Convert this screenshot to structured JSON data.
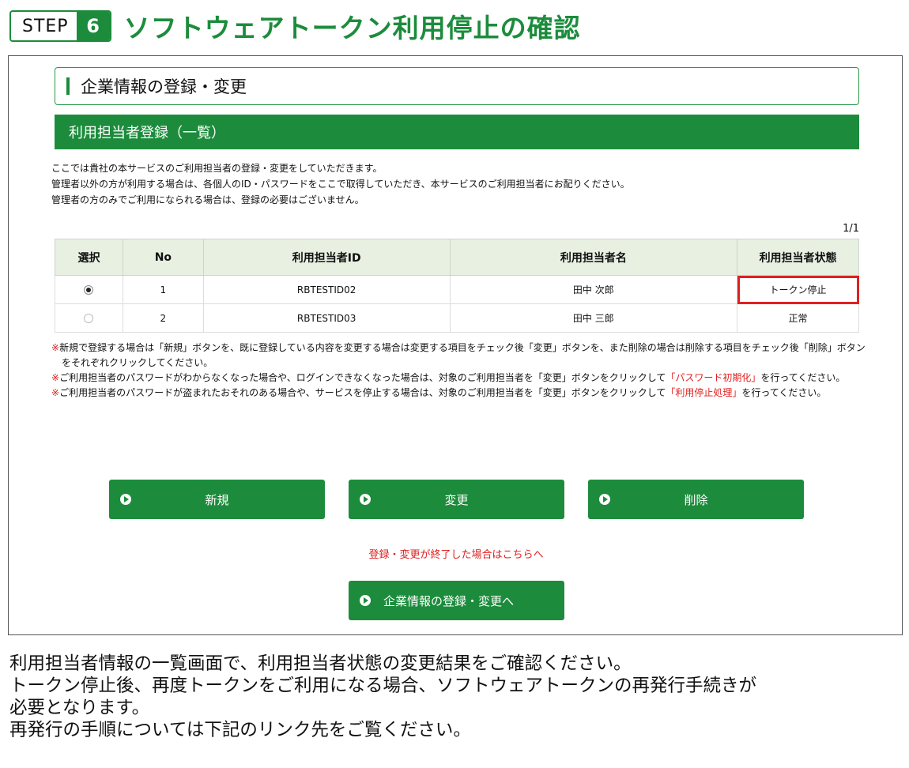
{
  "step": {
    "word": "STEP",
    "number": "6",
    "title": "ソフトウェアトークン利用停止の確認"
  },
  "section_title": "企業情報の登録・変更",
  "band_title": "利用担当者登録（一覧）",
  "intro_lines": [
    "ここでは貴社の本サービスのご利用担当者の登録・変更をしていただきます。",
    "管理者以外の方が利用する場合は、各個人のID・パスワードをここで取得していただき、本サービスのご利用担当者にお配りください。",
    "管理者の方のみでご利用になられる場合は、登録の必要はございません。"
  ],
  "pager": "1/1",
  "table": {
    "headers": [
      "選択",
      "No",
      "利用担当者ID",
      "利用担当者名",
      "利用担当者状態"
    ],
    "rows": [
      {
        "selected": true,
        "no": "1",
        "id": "RBTESTID02",
        "name": "田中 次郎",
        "state": "トークン停止"
      },
      {
        "selected": false,
        "no": "2",
        "id": "RBTESTID03",
        "name": "田中 三郎",
        "state": "正常"
      }
    ]
  },
  "notes": {
    "mark": "※",
    "n1": "新規で登録する場合は「新規」ボタンを、既に登録している内容を変更する場合は変更する項目をチェック後「変更」ボタンを、また削除の場合は削除する項目をチェック後「削除」ボタンをそれぞれクリックしてください。",
    "n2_pre": "ご利用担当者のパスワードがわからなくなった場合や、ログインできなくなった場合は、対象のご利用担当者を「変更」ボタンをクリックして",
    "n2_red": "「パスワード初期化」",
    "n2_post": "を行ってください。",
    "n3_pre": "ご利用担当者のパスワードが盗まれたおそれのある場合や、サービスを停止する場合は、対象のご利用担当者を「変更」ボタンをクリックして",
    "n3_red": "「利用停止処理」",
    "n3_post": "を行ってください。"
  },
  "buttons": {
    "new": "新規",
    "change": "変更",
    "delete": "削除",
    "back": "企業情報の登録・変更へ"
  },
  "finish_note": "登録・変更が終了した場合はこちらへ",
  "caption_lines": [
    "利用担当者情報の一覧画面で、利用担当者状態の変更結果をご確認ください。",
    "トークン停止後、再度トークンをご利用になる場合、ソフトウェアトークンの再発行手続きが",
    "必要となります。",
    "再発行の手順については下記のリンク先をご覧ください。"
  ],
  "colors": {
    "accent": "#1c8c3c",
    "highlight": "#e02020"
  }
}
